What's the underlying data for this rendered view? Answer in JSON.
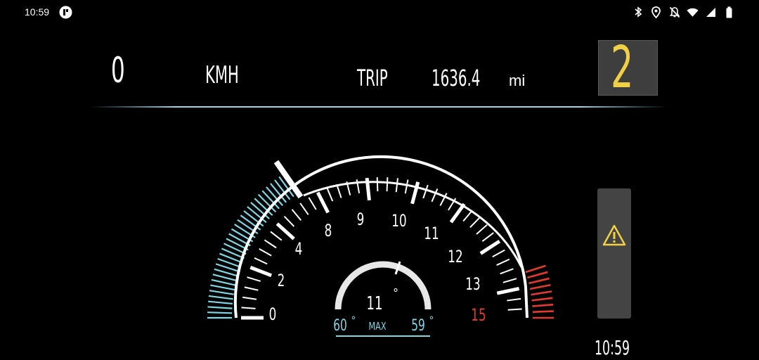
{
  "status_bar": {
    "time": "10:59",
    "app_icon": "cluster-app-icon",
    "icons": [
      "bluetooth-icon",
      "location-icon",
      "notifications-off-icon",
      "wifi-icon",
      "cellular-signal-icon",
      "battery-icon"
    ]
  },
  "header": {
    "speed_value": "0",
    "speed_unit": "KMH",
    "trip_label": "TRIP",
    "trip_value": "1636.4",
    "trip_unit": "mi",
    "gear": "2"
  },
  "tachometer": {
    "labels": [
      "0",
      "2",
      "4",
      "8",
      "9",
      "10",
      "11",
      "12",
      "13",
      "15"
    ],
    "redline_label": "15",
    "center_value": "11",
    "degree_symbol": "°",
    "left_temp": "60",
    "right_temp": "59",
    "max_label": "MAX"
  },
  "side_panel": {
    "warning_icon": "warning-triangle-icon",
    "clock": "10:59"
  },
  "colors": {
    "background": "#000000",
    "gear_color": "#f2d046",
    "accent_cyan": "#7fd6e4",
    "redline": "#e23b2e",
    "panel_gray": "#444444"
  }
}
